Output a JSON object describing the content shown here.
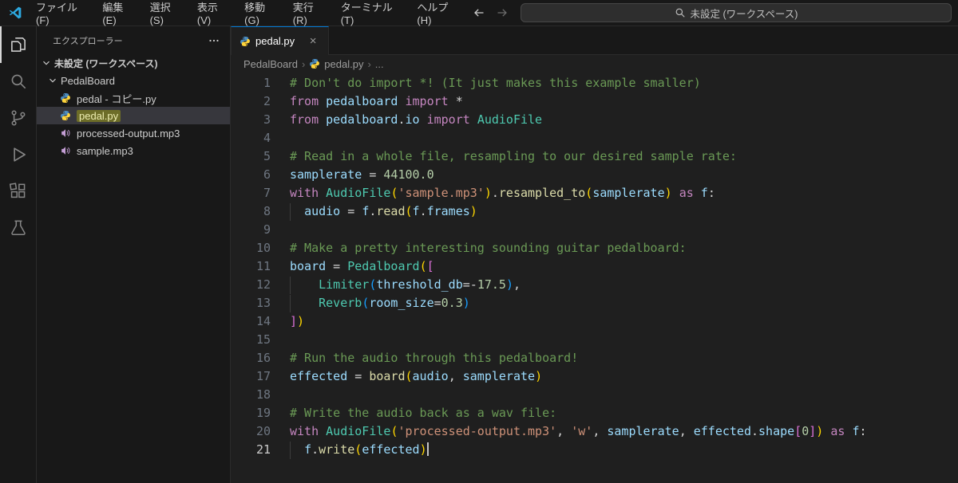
{
  "titlebar": {
    "menus": [
      {
        "id": "file",
        "label": "ファイル(F)"
      },
      {
        "id": "edit",
        "label": "編集(E)"
      },
      {
        "id": "selection",
        "label": "選択(S)"
      },
      {
        "id": "view",
        "label": "表示(V)"
      },
      {
        "id": "go",
        "label": "移動(G)"
      },
      {
        "id": "run",
        "label": "実行(R)"
      },
      {
        "id": "terminal",
        "label": "ターミナル(T)"
      },
      {
        "id": "help",
        "label": "ヘルプ(H)"
      }
    ],
    "search_label": "未設定 (ワークスペース)"
  },
  "activity_bar": {
    "items": [
      {
        "id": "explorer",
        "icon": "explorer",
        "active": true
      },
      {
        "id": "search",
        "icon": "search",
        "active": false
      },
      {
        "id": "source-control",
        "icon": "scm",
        "active": false
      },
      {
        "id": "run-debug",
        "icon": "run",
        "active": false
      },
      {
        "id": "extensions",
        "icon": "extensions",
        "active": false
      },
      {
        "id": "testing",
        "icon": "testing",
        "active": false
      }
    ]
  },
  "sidebar": {
    "title": "エクスプローラー",
    "workspace": "未設定 (ワークスペース)",
    "folder": "PedalBoard",
    "files": [
      {
        "name": "pedal - コピー.py",
        "icon": "python",
        "selected": false,
        "highlighted": false
      },
      {
        "name": "pedal.py",
        "icon": "python",
        "selected": true,
        "highlighted": true
      },
      {
        "name": "processed-output.mp3",
        "icon": "audio",
        "selected": false,
        "highlighted": false
      },
      {
        "name": "sample.mp3",
        "icon": "audio",
        "selected": false,
        "highlighted": false
      }
    ]
  },
  "editor": {
    "tab": {
      "label": "pedal.py",
      "close_glyph": "×"
    },
    "breadcrumbs": [
      "PedalBoard",
      "pedal.py",
      "..."
    ],
    "breadcrumb_separator": "›",
    "code": {
      "language": "python",
      "lines": [
        {
          "tokens": [
            [
              "cm",
              "# Don't do import *! (It just makes this example smaller)"
            ]
          ]
        },
        {
          "tokens": [
            [
              "kw",
              "from"
            ],
            [
              "op",
              " "
            ],
            [
              "var",
              "pedalboard"
            ],
            [
              "op",
              " "
            ],
            [
              "kw",
              "import"
            ],
            [
              "op",
              " *"
            ]
          ]
        },
        {
          "tokens": [
            [
              "kw",
              "from"
            ],
            [
              "op",
              " "
            ],
            [
              "var",
              "pedalboard"
            ],
            [
              "op",
              "."
            ],
            [
              "var",
              "io"
            ],
            [
              "op",
              " "
            ],
            [
              "kw",
              "import"
            ],
            [
              "op",
              " "
            ],
            [
              "cls",
              "AudioFile"
            ]
          ]
        },
        {
          "tokens": []
        },
        {
          "tokens": [
            [
              "cm",
              "# Read in a whole file, resampling to our desired sample rate:"
            ]
          ]
        },
        {
          "tokens": [
            [
              "var",
              "samplerate"
            ],
            [
              "op",
              " = "
            ],
            [
              "num",
              "44100.0"
            ]
          ]
        },
        {
          "tokens": [
            [
              "kw",
              "with"
            ],
            [
              "op",
              " "
            ],
            [
              "cls",
              "AudioFile"
            ],
            [
              "b1",
              "("
            ],
            [
              "str",
              "'sample.mp3'"
            ],
            [
              "b1",
              ")"
            ],
            [
              "op",
              "."
            ],
            [
              "fn",
              "resampled_to"
            ],
            [
              "b1",
              "("
            ],
            [
              "var",
              "samplerate"
            ],
            [
              "b1",
              ")"
            ],
            [
              "op",
              " "
            ],
            [
              "kw",
              "as"
            ],
            [
              "op",
              " "
            ],
            [
              "var",
              "f"
            ],
            [
              "op",
              ":"
            ]
          ]
        },
        {
          "guide": true,
          "tokens": [
            [
              "op",
              "  "
            ],
            [
              "var",
              "audio"
            ],
            [
              "op",
              " = "
            ],
            [
              "var",
              "f"
            ],
            [
              "op",
              "."
            ],
            [
              "fn",
              "read"
            ],
            [
              "b1",
              "("
            ],
            [
              "var",
              "f"
            ],
            [
              "op",
              "."
            ],
            [
              "var",
              "frames"
            ],
            [
              "b1",
              ")"
            ]
          ]
        },
        {
          "tokens": []
        },
        {
          "tokens": [
            [
              "cm",
              "# Make a pretty interesting sounding guitar pedalboard:"
            ]
          ]
        },
        {
          "tokens": [
            [
              "var",
              "board"
            ],
            [
              "op",
              " = "
            ],
            [
              "cls",
              "Pedalboard"
            ],
            [
              "b1",
              "("
            ],
            [
              "b2",
              "["
            ]
          ]
        },
        {
          "guide": true,
          "tokens": [
            [
              "op",
              "    "
            ],
            [
              "cls",
              "Limiter"
            ],
            [
              "b3",
              "("
            ],
            [
              "var",
              "threshold_db"
            ],
            [
              "op",
              "=-"
            ],
            [
              "num",
              "17.5"
            ],
            [
              "b3",
              ")"
            ],
            [
              "op",
              ","
            ]
          ]
        },
        {
          "guide": true,
          "tokens": [
            [
              "op",
              "    "
            ],
            [
              "cls",
              "Reverb"
            ],
            [
              "b3",
              "("
            ],
            [
              "var",
              "room_size"
            ],
            [
              "op",
              "="
            ],
            [
              "num",
              "0.3"
            ],
            [
              "b3",
              ")"
            ]
          ]
        },
        {
          "tokens": [
            [
              "b2",
              "]"
            ],
            [
              "b1",
              ")"
            ]
          ]
        },
        {
          "tokens": []
        },
        {
          "tokens": [
            [
              "cm",
              "# Run the audio through this pedalboard!"
            ]
          ]
        },
        {
          "tokens": [
            [
              "var",
              "effected"
            ],
            [
              "op",
              " = "
            ],
            [
              "fn",
              "board"
            ],
            [
              "b1",
              "("
            ],
            [
              "var",
              "audio"
            ],
            [
              "op",
              ", "
            ],
            [
              "var",
              "samplerate"
            ],
            [
              "b1",
              ")"
            ]
          ]
        },
        {
          "tokens": []
        },
        {
          "tokens": [
            [
              "cm",
              "# Write the audio back as a wav file:"
            ]
          ]
        },
        {
          "tokens": [
            [
              "kw",
              "with"
            ],
            [
              "op",
              " "
            ],
            [
              "cls",
              "AudioFile"
            ],
            [
              "b1",
              "("
            ],
            [
              "str",
              "'processed-output.mp3'"
            ],
            [
              "op",
              ", "
            ],
            [
              "str",
              "'w'"
            ],
            [
              "op",
              ", "
            ],
            [
              "var",
              "samplerate"
            ],
            [
              "op",
              ", "
            ],
            [
              "var",
              "effected"
            ],
            [
              "op",
              "."
            ],
            [
              "var",
              "shape"
            ],
            [
              "b2",
              "["
            ],
            [
              "num",
              "0"
            ],
            [
              "b2",
              "]"
            ],
            [
              "b1",
              ")"
            ],
            [
              "op",
              " "
            ],
            [
              "kw",
              "as"
            ],
            [
              "op",
              " "
            ],
            [
              "var",
              "f"
            ],
            [
              "op",
              ":"
            ]
          ]
        },
        {
          "guide": true,
          "active": true,
          "cursor": true,
          "tokens": [
            [
              "op",
              "  "
            ],
            [
              "var",
              "f"
            ],
            [
              "op",
              "."
            ],
            [
              "fn",
              "write"
            ],
            [
              "b1",
              "("
            ],
            [
              "var",
              "effected"
            ],
            [
              "b1",
              ")"
            ]
          ]
        }
      ]
    }
  },
  "colors": {
    "accent": "#0078d4",
    "comment": "#6A9955",
    "keyword": "#C586C0",
    "variable": "#9CDCFE",
    "class_name": "#4EC9B0",
    "function_name": "#DCDCAA",
    "string": "#CE9178",
    "number": "#B5CEA8",
    "default_text": "#D4D4D4",
    "bracket1": "#FFD700",
    "bracket2": "#DA70D6",
    "bracket3": "#179FFF",
    "selection_row": "#37373d",
    "filename_highlight": "#6d6d28"
  }
}
